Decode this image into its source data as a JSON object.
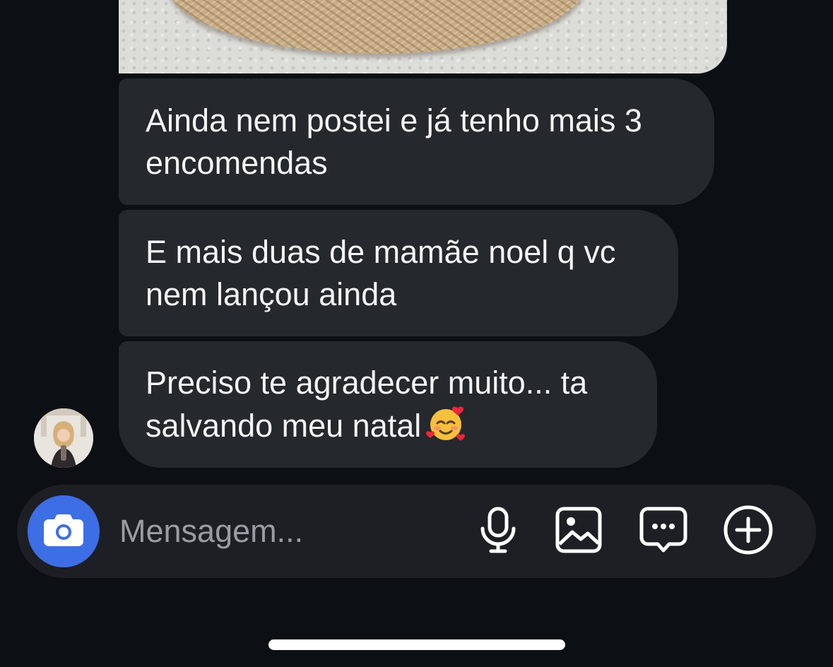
{
  "messages": [
    {
      "text": "Ainda nem postei e já tenho mais 3\nencomendas"
    },
    {
      "text": "E mais duas de mamãe noel q vc\nnem lançou ainda"
    },
    {
      "text": "Preciso te agradecer muito... ta\nsalvando meu natal",
      "emoji": "smiling-face-with-hearts"
    }
  ],
  "composer": {
    "placeholder": "Mensagem...",
    "camera_icon": "camera-icon",
    "tools": [
      "microphone-icon",
      "gallery-icon",
      "chat-bubble-dots-icon",
      "add-circle-icon"
    ]
  },
  "colors": {
    "background": "#0c0f14",
    "bubble": "#25282d",
    "composer": "#1d1f24",
    "camera_button": "#3d6ee6",
    "placeholder": "#9a9ca3"
  }
}
